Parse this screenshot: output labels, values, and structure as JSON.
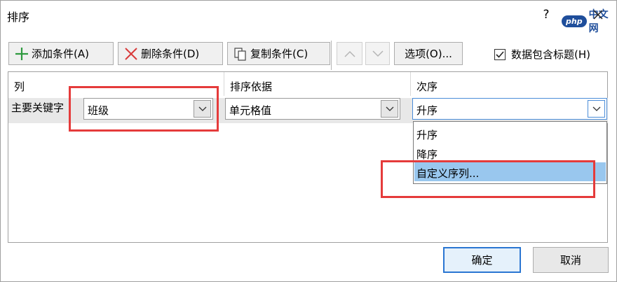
{
  "dialog": {
    "title": "排序",
    "help": "?",
    "watermark_badge": "php",
    "watermark_text": "中文网"
  },
  "toolbar": {
    "add_label": "添加条件(A)",
    "delete_label": "删除条件(D)",
    "copy_label": "复制条件(C)",
    "options_label": "选项(O)...",
    "has_header_label": "数据包含标题(H)",
    "has_header_checked": true
  },
  "grid": {
    "headers": {
      "column": "列",
      "sort_on": "排序依据",
      "order": "次序"
    },
    "row": {
      "label": "主要关键字",
      "column_value": "班级",
      "sort_on_value": "单元格值",
      "order_value": "升序"
    },
    "order_options": [
      "升序",
      "降序",
      "自定义序列..."
    ],
    "selected_option_index": 2
  },
  "footer": {
    "ok_label": "确定",
    "cancel_label": "取消"
  },
  "colors": {
    "highlight": "#e53b3b",
    "selection": "#99c7ee",
    "accent": "#2a76d2"
  }
}
